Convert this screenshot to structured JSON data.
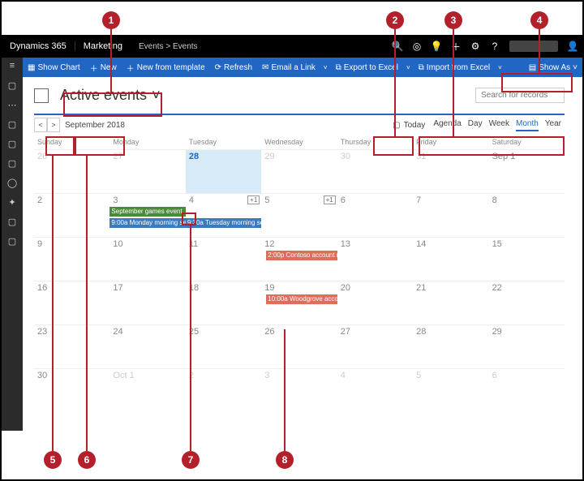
{
  "topbar": {
    "brand": "Dynamics 365",
    "app": "Marketing",
    "crumb1": "Events",
    "crumb2": "Events"
  },
  "cmd": {
    "showchart": "Show Chart",
    "new": "New",
    "newtemplate": "New from template",
    "refresh": "Refresh",
    "emaillink": "Email a Link",
    "exportexcel": "Export to Excel",
    "importexcel": "Import from Excel",
    "showas": "Show As"
  },
  "view": {
    "name": "Active events",
    "search_placeholder": "Search for records"
  },
  "cal": {
    "monthlabel": "September 2018",
    "today": "Today",
    "tabs": {
      "agenda": "Agenda",
      "day": "Day",
      "week": "Week",
      "month": "Month",
      "year": "Year"
    },
    "dayheaders": [
      "Sunday",
      "Monday",
      "Tuesday",
      "Wednesday",
      "Thursday",
      "Friday",
      "Saturday"
    ],
    "more_label": "+1",
    "cells": [
      [
        "26",
        "27",
        "28",
        "29",
        "30",
        "31",
        "Sep 1"
      ],
      [
        "2",
        "3",
        "4",
        "5",
        "6",
        "7",
        "8"
      ],
      [
        "9",
        "10",
        "11",
        "12",
        "13",
        "14",
        "15"
      ],
      [
        "16",
        "17",
        "18",
        "19",
        "20",
        "21",
        "22"
      ],
      [
        "23",
        "24",
        "25",
        "26",
        "27",
        "28",
        "29"
      ],
      [
        "30",
        "Oct 1",
        "2",
        "3",
        "4",
        "5",
        "6"
      ]
    ],
    "events": {
      "sept_games": "September games event",
      "mon_morning": "9:00a Monday morning ses...",
      "tue_morning": "9:30a Tuesday morning sess...",
      "contoso": "2:00p Contoso account revi...",
      "woodgrove": "10:00a Woodgrove account ..."
    }
  },
  "callouts": [
    "1",
    "2",
    "3",
    "4",
    "5",
    "6",
    "7",
    "8"
  ]
}
